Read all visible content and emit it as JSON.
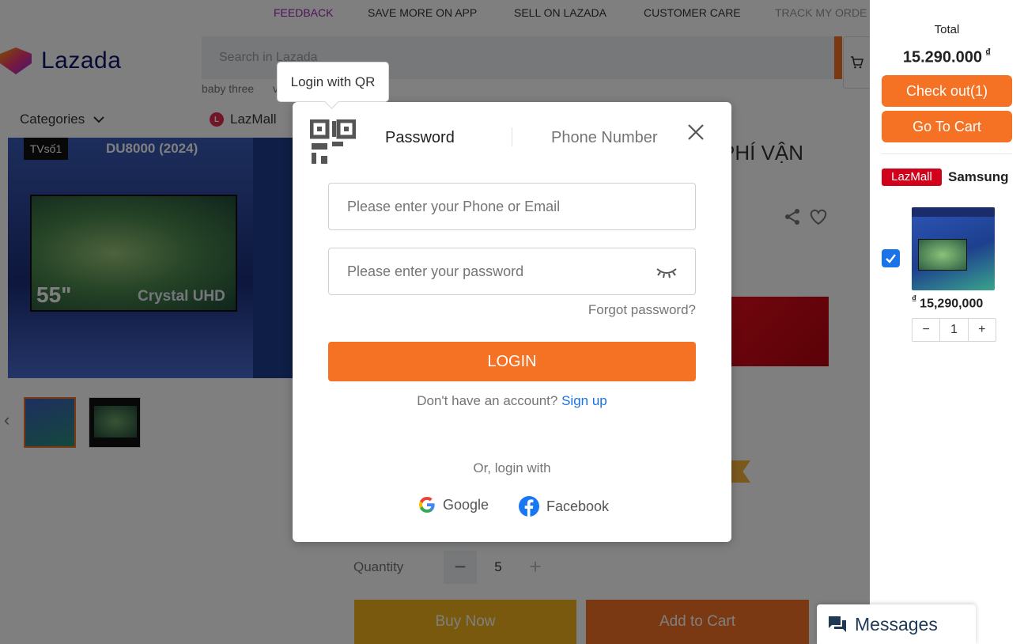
{
  "topbar": {
    "items": [
      "FEEDBACK",
      "SAVE MORE ON APP",
      "SELL ON LAZADA",
      "CUSTOMER CARE",
      "TRACK MY ORDE"
    ]
  },
  "header": {
    "logo_text": "Lazada",
    "search_placeholder": "Search in Lazada",
    "search_hints": [
      "baby three",
      "v"
    ],
    "categories_label": "Categories",
    "lazmall_label": "LazMall"
  },
  "product": {
    "image_badge": "TVsố1",
    "image_model": "DU8000 (2024)",
    "image_size": "55\"",
    "image_label": "Crystal UHD",
    "title_fragment": "PHÍ VẬN",
    "quantity_label": "Quantity",
    "quantity_value": "5",
    "buy_now_label": "Buy Now",
    "add_to_cart_label": "Add to Cart"
  },
  "login_modal": {
    "tooltip": "Login with QR",
    "tabs": [
      "Password",
      "Phone Number"
    ],
    "username_placeholder": "Please enter your Phone or Email",
    "password_placeholder": "Please enter your password",
    "forgot_password": "Forgot password?",
    "login_button": "LOGIN",
    "signup_prompt": "Don't have an account?",
    "signup_link": "Sign up",
    "or_login_with": "Or, login with",
    "social": [
      "Google",
      "Facebook"
    ]
  },
  "cart_sidebar": {
    "total_label": "Total",
    "total_value": "15.290.000",
    "currency": "₫",
    "checkout_label": "Check out(1)",
    "go_to_cart_label": "Go To Cart",
    "store_badge": "LazMall",
    "store_name": "Samsung",
    "item_price": "15,290,000",
    "item_quantity": "1",
    "minus": "−",
    "plus": "+"
  },
  "messages": {
    "label": "Messages"
  },
  "colors": {
    "brand_orange": "#f57224",
    "link_blue": "#1a73e8",
    "lazmall_red": "#d0021b"
  }
}
